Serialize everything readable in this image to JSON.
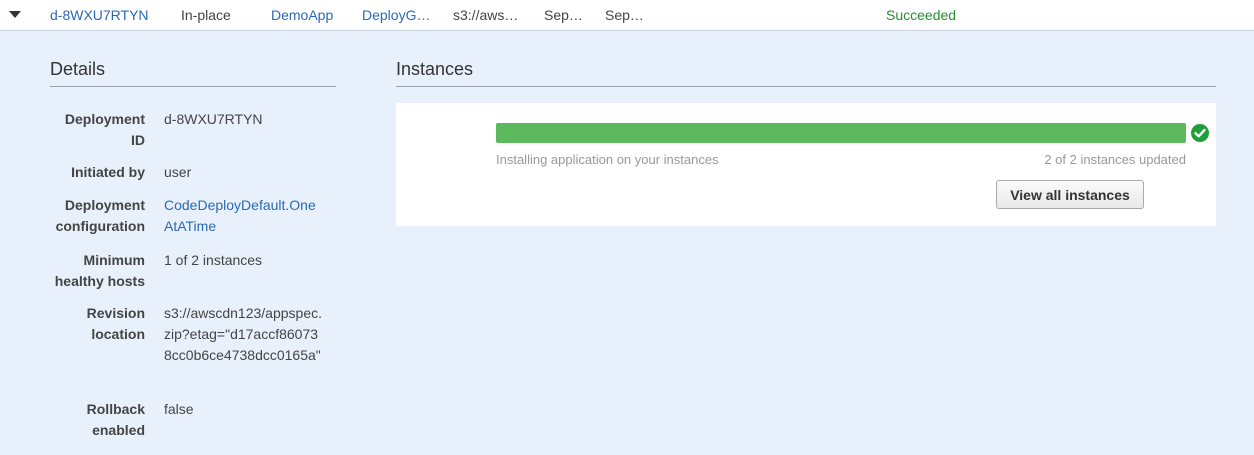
{
  "row": {
    "deployment_id": "d-8WXU7RTYN",
    "type": "In-place",
    "application": "DemoApp",
    "deployment_group": "DeployG…",
    "revision": "s3://aws…",
    "start": "Sep…",
    "end": "Sep…",
    "status": "Succeeded"
  },
  "details": {
    "title": "Details",
    "deployment_id_label": "Deployment ID",
    "deployment_id": "d-8WXU7RTYN",
    "initiated_by_label": "Initiated by",
    "initiated_by": "user",
    "config_label": "Deployment configuration",
    "config": "CodeDeployDefault.OneAtATime",
    "min_hosts_label": "Minimum healthy hosts",
    "min_hosts": "1 of 2 instances",
    "revision_label": "Revision location",
    "revision": "s3://awscdn123/appspec.zip?etag=\"d17accf860738cc0b6ce4738dcc0165a\"",
    "rollback_label": "Rollback enabled",
    "rollback": "false"
  },
  "instances": {
    "title": "Instances",
    "progress": 1.0,
    "status_text": "Installing application on your instances",
    "count_text": "2 of 2 instances updated",
    "view_all_label": "View all instances"
  },
  "colors": {
    "link": "#2a6ab4",
    "success": "#23912f",
    "progress": "#5cb85c"
  },
  "icons": {
    "toggle": "caret-down-icon",
    "check": "check-circle-icon"
  }
}
